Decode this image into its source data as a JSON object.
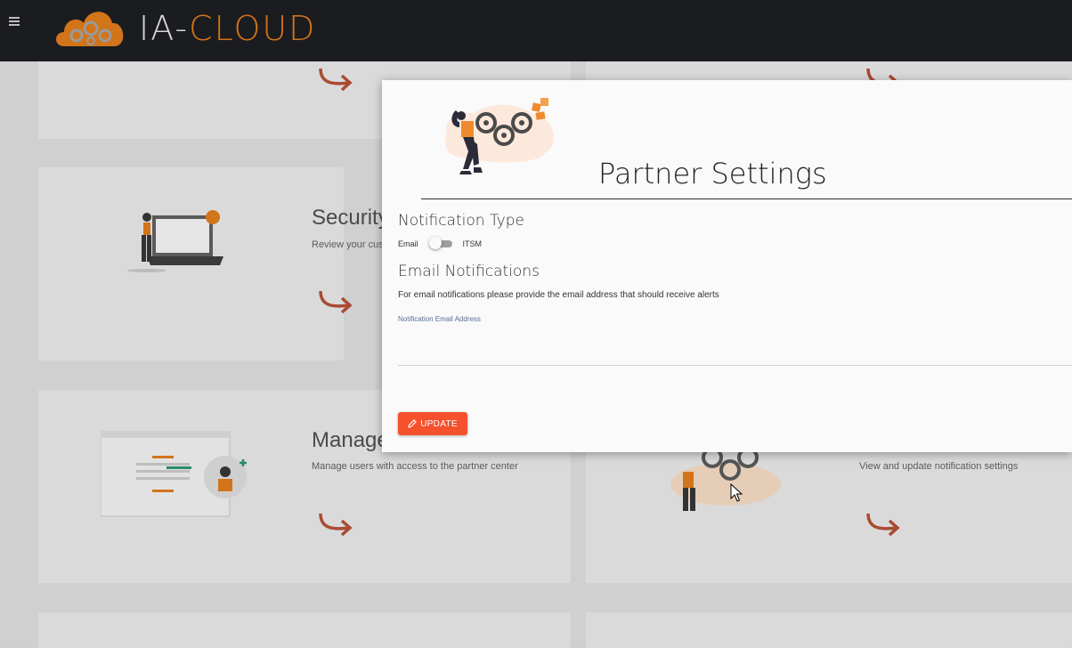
{
  "header": {
    "logo_text_ia": "IA-",
    "logo_text_cloud": "CLOUD",
    "menu_icon": "hamburger-icon"
  },
  "background_cards": [
    {
      "title": "Security",
      "description": "Review your custo"
    },
    {
      "title": "Manage",
      "description": "Manage users with access to the partner center"
    },
    {
      "title": "",
      "description": "View and update notification settings"
    }
  ],
  "modal": {
    "title": "Partner Settings",
    "notification_type_heading": "Notification Type",
    "toggle_left_label": "Email",
    "toggle_right_label": "ITSM",
    "toggle_state": "Email",
    "email_heading": "Email Notifications",
    "email_help": "For email notifications please provide the email address that should receive alerts",
    "email_field_label": "Notification Email Address",
    "email_field_value": "",
    "update_label": "UPDATE",
    "update_icon": "pencil-icon"
  },
  "colors": {
    "accent": "#f4512c",
    "brand_orange": "#d2741a",
    "header_bg": "#1a1c20"
  }
}
